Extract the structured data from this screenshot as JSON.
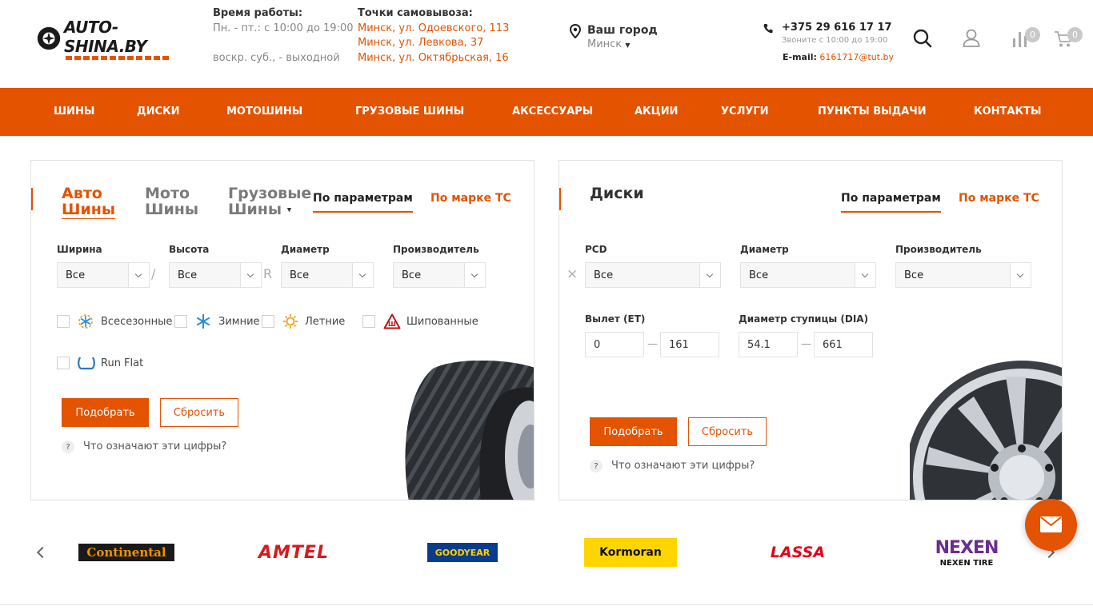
{
  "colors": {
    "accent": "#e35300",
    "nav_bg": "#e35300",
    "text": "#222222"
  },
  "header": {
    "logo_text": "AUTO-SHINA.BY",
    "hours_title": "Время работы:",
    "hours_weekdays": "Пн. - пт.: с 10:00 до 19:00",
    "hours_weekend": "воскр. суб., - выходной",
    "pickup_title": "Точки самовывоза:",
    "pickup_points": [
      "Минск, ул. Одоевского, 113",
      "Минск, ул. Левкова, 37",
      "Минск, ул. Октябрьская, 16"
    ],
    "city_label": "Ваш город",
    "city_value": "Минск",
    "phone": "+375 29 616 17 17",
    "phone_hours": "Звоните с 10:00 до 19:00",
    "email_label": "E-mail:",
    "email": "6161717@tut.by",
    "compare_count": "0",
    "cart_count": "0",
    "icons": [
      "location-icon",
      "phone-icon",
      "search-icon",
      "user-icon",
      "compare-icon",
      "cart-icon"
    ]
  },
  "nav": [
    "ШИНЫ",
    "ДИСКИ",
    "МОТОШИНЫ",
    "ГРУЗОВЫЕ ШИНЫ",
    "АКСЕССУАРЫ",
    "АКЦИИ",
    "УСЛУГИ",
    "ПУНКТЫ ВЫДАЧИ",
    "КОНТАКТЫ"
  ],
  "tires": {
    "cat_auto_1": "Авто",
    "cat_auto_2": "Шины",
    "cat_moto_1": "Мото",
    "cat_moto_2": "Шины",
    "cat_truck_1": "Грузовые",
    "cat_truck_2": "Шины",
    "mode_params": "По параметрам",
    "mode_brand": "По марке ТС",
    "width_label": "Ширина",
    "height_label": "Высота",
    "diameter_label": "Диаметр",
    "maker_label": "Производитель",
    "width_value": "Все",
    "height_value": "Все",
    "diameter_value": "Все",
    "maker_value": "Все",
    "sep_slash": "/",
    "sep_r": "R",
    "season_all": "Всесезонные",
    "season_winter": "Зимние",
    "season_summer": "Летние",
    "studded": "Шипованные",
    "runflat": "Run Flat",
    "submit": "Подобрать",
    "reset": "Сбросить",
    "help_q": "?",
    "help": "Что означают эти цифры?"
  },
  "disks": {
    "title": "Диски",
    "mode_params": "По параметрам",
    "mode_brand": "По марке ТС",
    "pcd_label": "PCD",
    "diameter_label": "Диаметр",
    "maker_label": "Производитель",
    "pcd_value": "Все",
    "diameter_value": "Все",
    "maker_value": "Все",
    "clear": "×",
    "et_label": "Вылет (ET)",
    "et_from": "0",
    "et_to": "161",
    "dia_label": "Диаметр ступицы (DIA)",
    "dia_from": "54.1",
    "dia_to": "661",
    "dash": "—",
    "submit": "Подобрать",
    "reset": "Сбросить",
    "help_q": "?",
    "help": "Что означают эти цифры?"
  },
  "brands": [
    "Continental",
    "AMTEL",
    "GOODYEAR",
    "Kormoran",
    "LASSA",
    "NEXEN",
    "NEXEN TIRE"
  ]
}
